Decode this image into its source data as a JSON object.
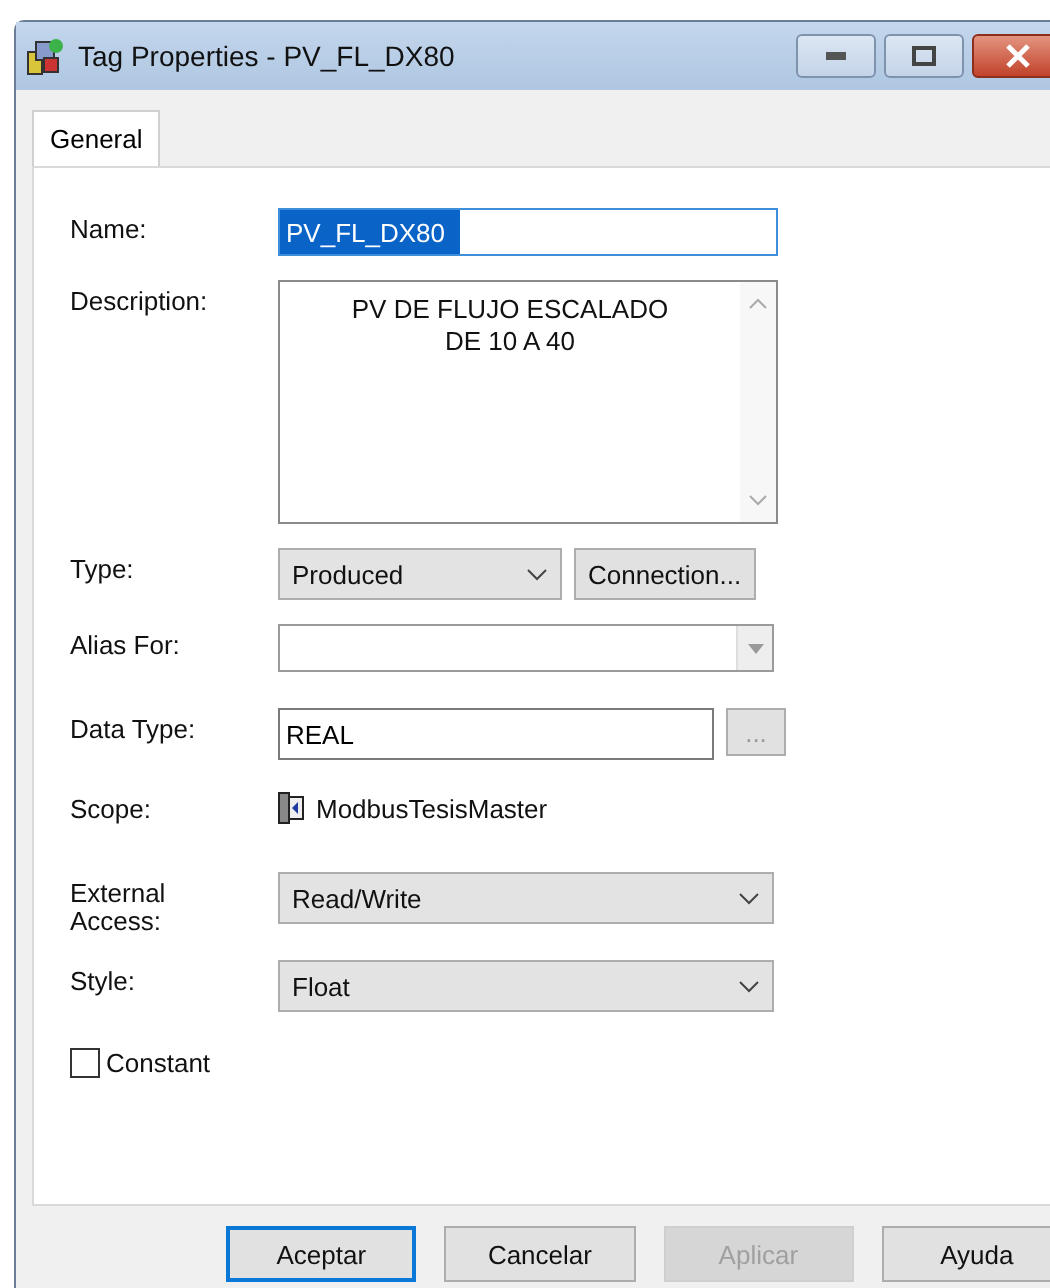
{
  "window": {
    "title": "Tag Properties - PV_FL_DX80"
  },
  "tabs": [
    {
      "label": "General",
      "selected": true
    }
  ],
  "rows": [
    {
      "kind": "text",
      "label": "Name:",
      "value": "PV_FL_DX80",
      "selected": true
    },
    {
      "kind": "textarea",
      "label": "Description:",
      "value": "PV DE FLUJO ESCALADO\nDE 10 A 40"
    },
    {
      "kind": "combo-button",
      "label": "Type:",
      "value": "Produced",
      "button": "Connection..."
    },
    {
      "kind": "combo-empty",
      "label": "Alias For:",
      "disabled": true
    },
    {
      "kind": "text-button",
      "label": "Data Type:",
      "value": "REAL",
      "button": "..."
    },
    {
      "kind": "scope",
      "label": "Scope:",
      "value": "ModbusTesisMaster"
    },
    {
      "kind": "combo",
      "label": "External\nAccess:",
      "value": "Read/Write"
    },
    {
      "kind": "combo",
      "label": "Style:",
      "value": "Float"
    },
    {
      "kind": "checkbox",
      "label": "Constant",
      "checked": false
    }
  ],
  "buttons": [
    {
      "label": "Aceptar",
      "default": true,
      "disabled": false
    },
    {
      "label": "Cancelar",
      "default": false,
      "disabled": false
    },
    {
      "label": "Aplicar",
      "default": false,
      "disabled": true
    },
    {
      "label": "Ayuda",
      "default": false,
      "disabled": false
    }
  ]
}
